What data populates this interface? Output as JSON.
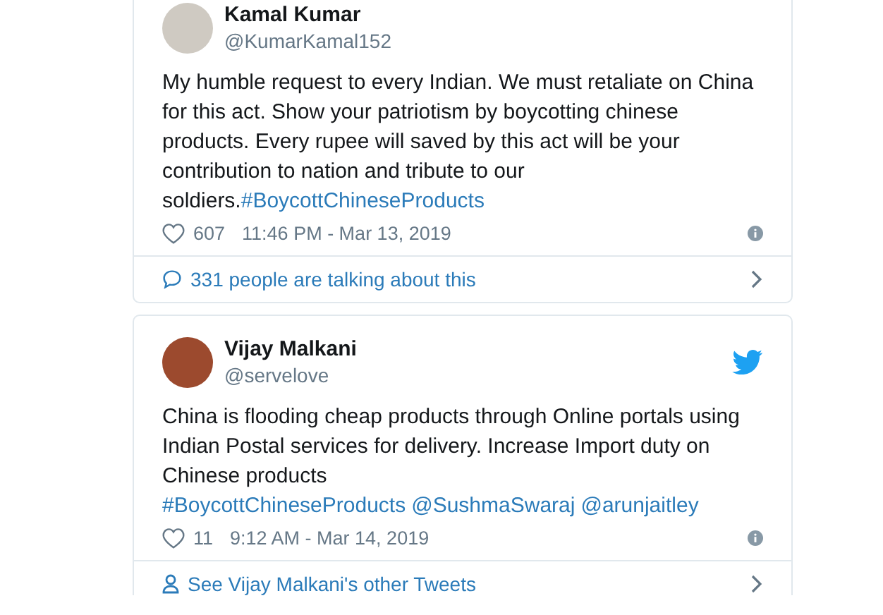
{
  "tweets": [
    {
      "name": "Kamal Kumar",
      "handle": "@KumarKamal152",
      "bird": false,
      "body": [
        {
          "kind": "plain",
          "text": "My humble request to every Indian. We must retaliate on China for this act. Show your patriotism by boycotting chinese products. Every rupee will saved by this act will be your contribution to nation and tribute to our soldiers."
        },
        {
          "kind": "link",
          "text": "#BoycottChineseProducts"
        }
      ],
      "likes": "607",
      "time": "11:46 PM - Mar 13, 2019",
      "footer": {
        "kind": "talking",
        "text": "331 people are talking about this"
      }
    },
    {
      "name": "Vijay Malkani",
      "handle": "@servelove",
      "bird": true,
      "body": [
        {
          "kind": "plain",
          "text": "China is flooding cheap products through Online portals using Indian Postal services for delivery. Increase Import duty on Chinese products "
        },
        {
          "kind": "link",
          "text": "#BoycottChineseProducts"
        },
        {
          "kind": "link",
          "text": "@SushmaSwaraj"
        },
        {
          "kind": "link",
          "text": "@arunjaitley"
        }
      ],
      "likes": "11",
      "time": "9:12 AM - Mar 14, 2019",
      "footer": {
        "kind": "profile",
        "text": "See Vijay Malkani's other Tweets"
      }
    }
  ]
}
